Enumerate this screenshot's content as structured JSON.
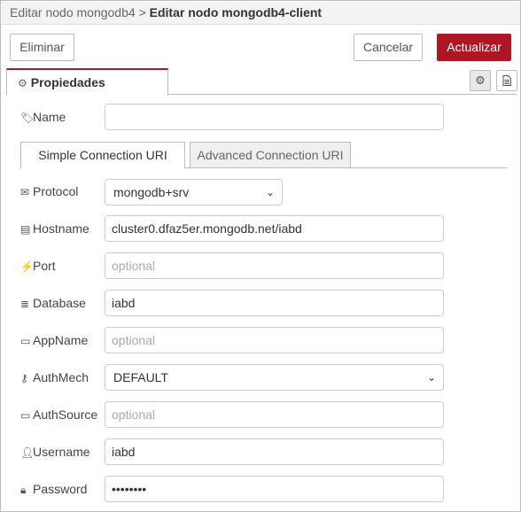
{
  "breadcrumb": {
    "parent": "Editar nodo mongodb4",
    "separator": ">",
    "current": "Editar nodo mongodb4-client"
  },
  "toolbar": {
    "delete_label": "Eliminar",
    "cancel_label": "Cancelar",
    "update_label": "Actualizar"
  },
  "tabs": {
    "properties_label": "Propiedades"
  },
  "fields": {
    "name": {
      "label": "Name",
      "value": "",
      "placeholder": ""
    },
    "protocol": {
      "label": "Protocol",
      "value": "mongodb+srv"
    },
    "hostname": {
      "label": "Hostname",
      "value": "cluster0.dfaz5er.mongodb.net/iabd"
    },
    "port": {
      "label": "Port",
      "value": "",
      "placeholder": "optional"
    },
    "database": {
      "label": "Database",
      "value": "iabd"
    },
    "appname": {
      "label": "AppName",
      "value": "",
      "placeholder": "optional"
    },
    "authmech": {
      "label": "AuthMech",
      "value": "DEFAULT"
    },
    "authsource": {
      "label": "AuthSource",
      "value": "",
      "placeholder": "optional"
    },
    "username": {
      "label": "Username",
      "value": "iabd"
    },
    "password": {
      "label": "Password",
      "value": "••••••••"
    }
  },
  "connection_tabs": {
    "simple_label": "Simple Connection URI",
    "advanced_label": "Advanced Connection URI"
  },
  "colors": {
    "accent": "#ad1625"
  }
}
